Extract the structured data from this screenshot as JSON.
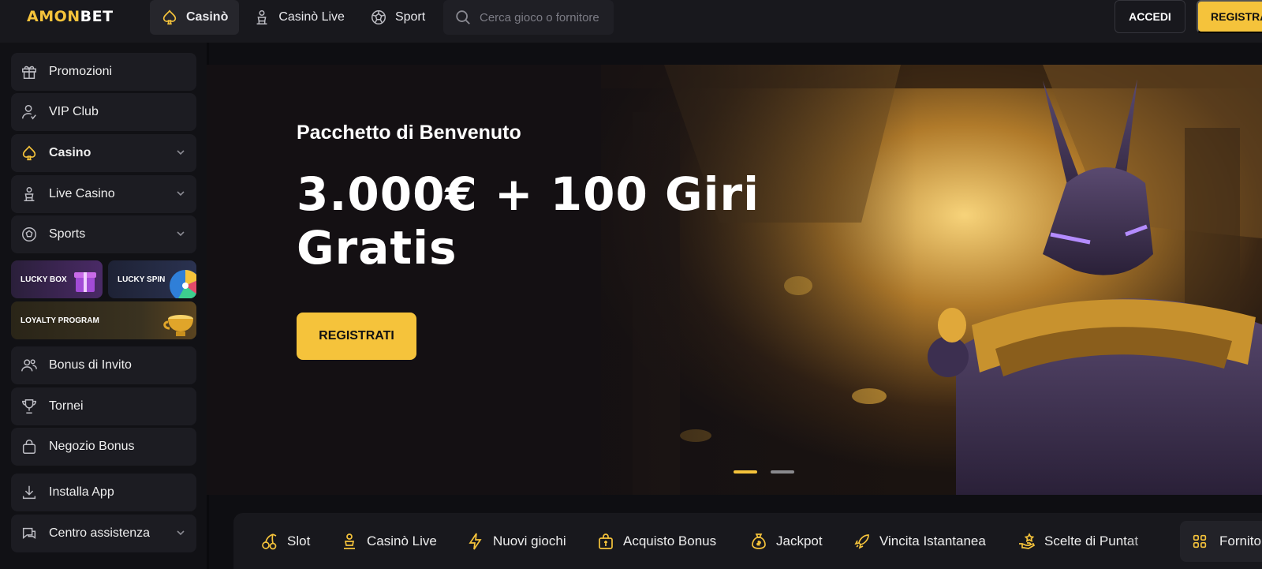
{
  "brand": {
    "logo_part1": "AMON",
    "logo_part2": "BET"
  },
  "topnav": {
    "items": [
      {
        "label": "Casinò",
        "icon": "spade-icon",
        "active": true
      },
      {
        "label": "Casinò Live",
        "icon": "dealer-icon",
        "active": false
      },
      {
        "label": "Sport",
        "icon": "soccer-ball-icon",
        "active": false
      }
    ],
    "search_placeholder": "Cerca gioco o fornitore",
    "login_label": "ACCEDI",
    "register_label": "REGISTRATI"
  },
  "sidebar": {
    "items": [
      {
        "label": "Promozioni",
        "icon": "gift-icon"
      },
      {
        "label": "VIP Club",
        "icon": "vip-user-icon"
      },
      {
        "label": "Casino",
        "icon": "spade-icon",
        "expandable": true
      },
      {
        "label": "Live Casino",
        "icon": "dealer-icon",
        "expandable": true
      },
      {
        "label": "Sports",
        "icon": "soccer-ball-icon",
        "expandable": true
      },
      {
        "label": "Bonus di Invito",
        "icon": "users-icon"
      },
      {
        "label": "Tornei",
        "icon": "trophy-icon"
      },
      {
        "label": "Negozio Bonus",
        "icon": "shop-bag-icon"
      },
      {
        "label": "Installa App",
        "icon": "download-icon"
      },
      {
        "label": "Centro assistenza",
        "icon": "chat-icon",
        "expandable": true
      }
    ],
    "tiles": {
      "lucky_box": "LUCKY BOX",
      "lucky_spin": "LUCKY SPIN",
      "loyalty": "LOYALTY PROGRAM"
    }
  },
  "hero": {
    "subtitle": "Pacchetto di Benvenuto",
    "title": "3.000€ + 100 Giri Gratis",
    "cta_label": "REGISTRATI",
    "slides_total": 2,
    "active_slide": 1
  },
  "categories": {
    "items": [
      {
        "label": "Slot",
        "icon": "cherries-icon"
      },
      {
        "label": "Casinò Live",
        "icon": "dealer-icon"
      },
      {
        "label": "Nuovi giochi",
        "icon": "lightning-icon"
      },
      {
        "label": "Acquisto Bonus",
        "icon": "bonus-buy-icon"
      },
      {
        "label": "Jackpot",
        "icon": "money-bag-icon"
      },
      {
        "label": "Vincita Istantanea",
        "icon": "rocket-icon"
      },
      {
        "label": "Scelte di Puntat",
        "icon": "hand-coins-icon"
      }
    ],
    "providers_label": "Fornitori",
    "providers_icon": "grid-icon"
  },
  "colors": {
    "accent": "#f5c33b",
    "background": "#111115",
    "panel": "#1c1c22"
  }
}
